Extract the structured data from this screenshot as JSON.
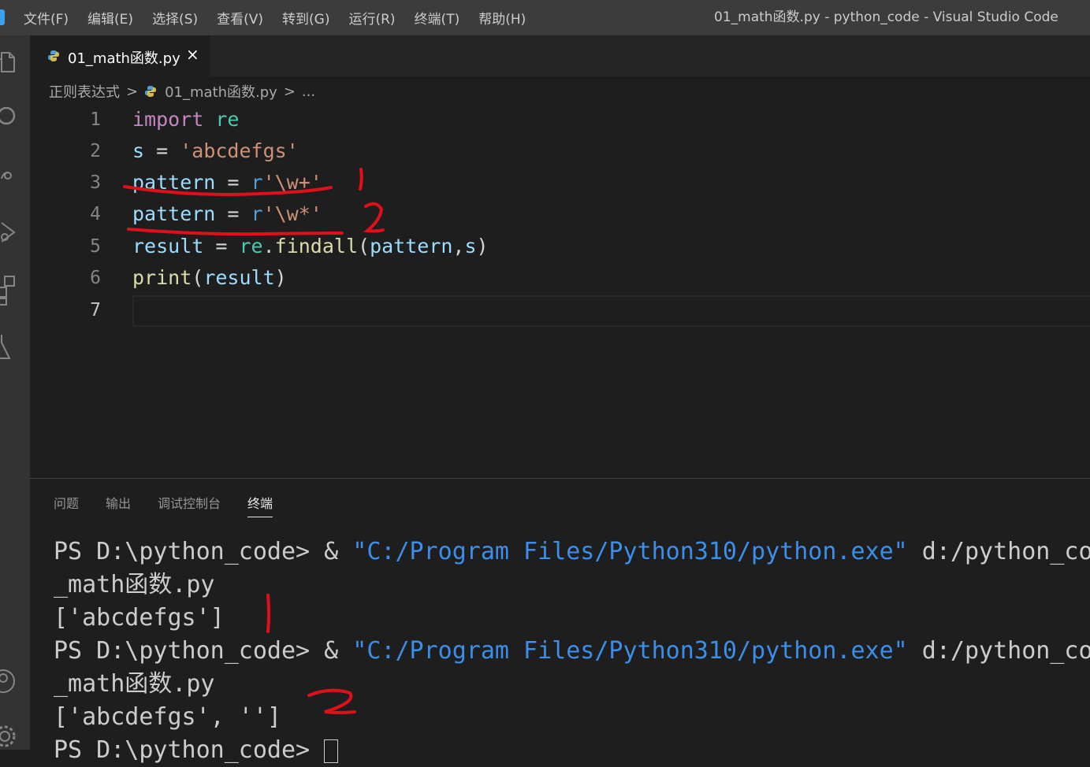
{
  "window": {
    "title": "01_math函数.py - python_code - Visual Studio Code"
  },
  "menu": [
    "文件(F)",
    "编辑(E)",
    "选择(S)",
    "查看(V)",
    "转到(G)",
    "运行(R)",
    "终端(T)",
    "帮助(H)"
  ],
  "activity_bar": [
    "explorer-icon",
    "search-icon",
    "source-control-icon",
    "run-debug-icon",
    "extensions-icon",
    "testing-icon",
    "account-icon",
    "settings-gear-icon"
  ],
  "tab": {
    "label": "01_math函数.py",
    "close": "×"
  },
  "breadcrumb": {
    "folder": "正则表达式",
    "file": "01_math函数.py",
    "more": "...",
    "separator": ">"
  },
  "editor": {
    "lines": [
      {
        "n": "1",
        "kw": "import",
        "mod": "re"
      },
      {
        "n": "2",
        "v": "s",
        "op": " = ",
        "str": "'abcdefgs'"
      },
      {
        "n": "3",
        "v": "pattern",
        "op": " = ",
        "prefix": "r",
        "str": "'\\w+'"
      },
      {
        "n": "4",
        "v": "pattern",
        "op": " = ",
        "prefix": "r",
        "str": "'\\w*'"
      },
      {
        "n": "5",
        "v": "result",
        "op": " = ",
        "mod": "re",
        "dot": ".",
        "fn": "findall",
        "open": "(",
        "arg1": "pattern",
        "comma": ",",
        "arg2": "s",
        "close": ")"
      },
      {
        "n": "6",
        "fn": "print",
        "open": "(",
        "arg": "result",
        "close": ")"
      },
      {
        "n": "7"
      }
    ]
  },
  "panel": {
    "tabs": [
      "问题",
      "输出",
      "调试控制台",
      "终端"
    ],
    "active": "终端"
  },
  "terminal": {
    "prompt": "PS D:\\python_code> ",
    "amp": "& ",
    "exe": "\"C:/Program Files/Python310/python.exe\"",
    "arg": " d:/python_co",
    "cont": "_math函数.py",
    "out1": "['abcdefgs']",
    "out2": "['abcdefgs', '']",
    "last_prompt": "PS D:\\python_code> "
  },
  "annotations": {
    "mark1": "1",
    "mark2": "2",
    "color": "#e0101a"
  }
}
